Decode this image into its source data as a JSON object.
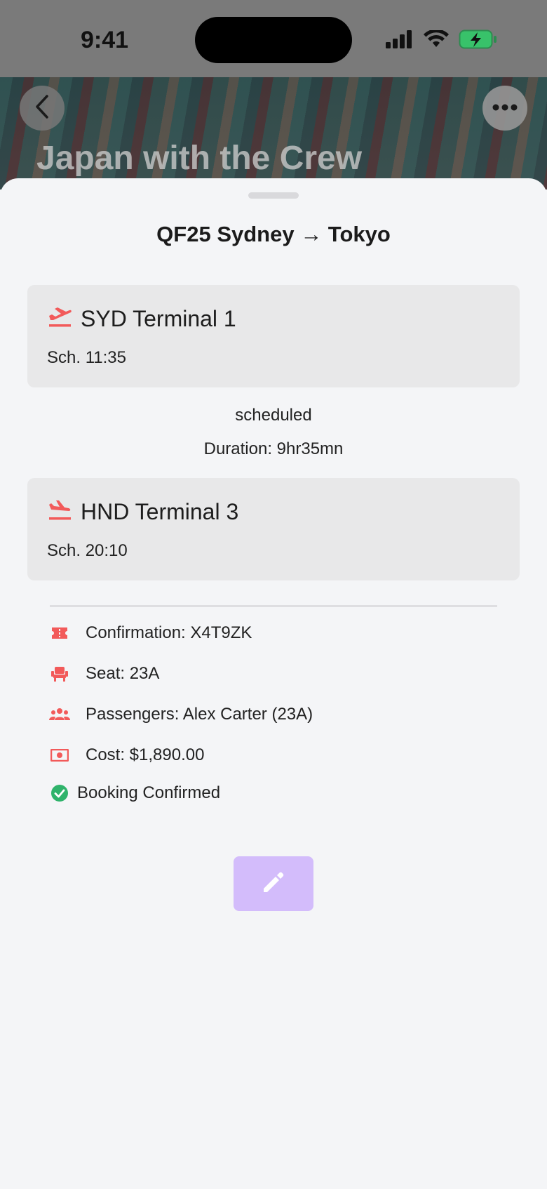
{
  "status_bar": {
    "time": "9:41"
  },
  "hero": {
    "title": "Japan with the Crew"
  },
  "sheet": {
    "title": "QF25 Sydney → Tokyo",
    "departure": {
      "airport": "SYD Terminal 1",
      "scheduled": "Sch. 11:35"
    },
    "status": "scheduled",
    "duration": "Duration: 9hr35mn",
    "arrival": {
      "airport": "HND Terminal 3",
      "scheduled": "Sch. 20:10"
    },
    "details": {
      "confirmation": "Confirmation: X4T9ZK",
      "seat": "Seat: 23A",
      "passengers": "Passengers: Alex Carter (23A)",
      "cost": "Cost: $1,890.00"
    },
    "booking_status": "Booking Confirmed"
  },
  "colors": {
    "accent": "#f25a5a",
    "success": "#2fb36b",
    "edit_button": "#d3bcfb"
  },
  "icons": {
    "back": "chevron-left-icon",
    "more": "more-horizontal-icon",
    "departure": "plane-departure-icon",
    "arrival": "plane-arrival-icon",
    "confirmation": "ticket-icon",
    "seat": "seat-icon",
    "passengers": "group-icon",
    "cost": "money-icon",
    "booking": "check-circle-icon",
    "edit": "pencil-icon"
  }
}
